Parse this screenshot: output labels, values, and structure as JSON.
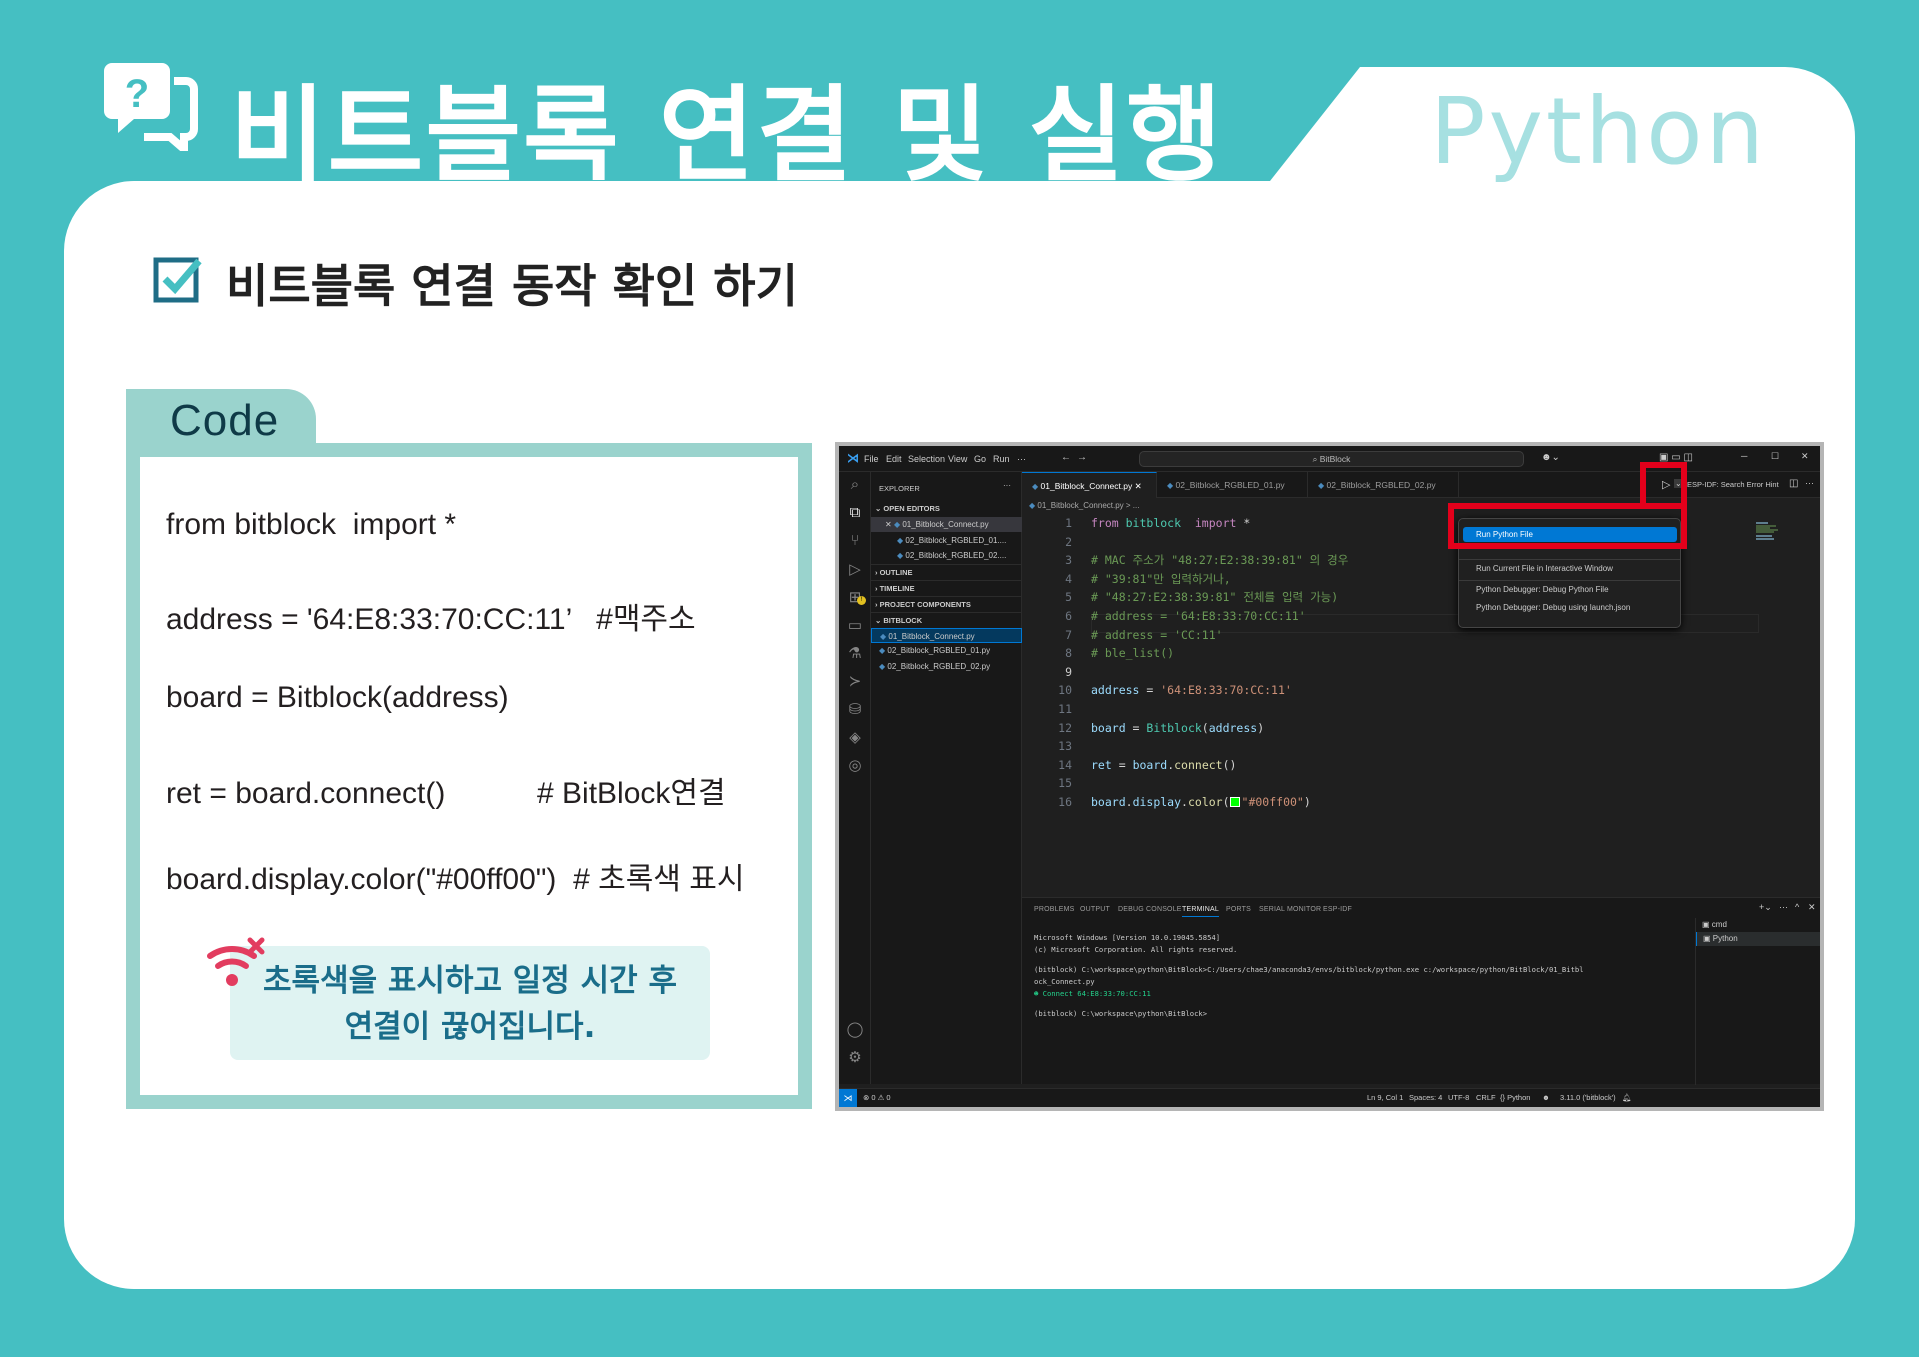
{
  "header": {
    "title": "비트블록 연결 및 실행",
    "language": "Python",
    "subtitle": "비트블록 연결 동작 확인 하기"
  },
  "code_panel": {
    "tab_label": "Code",
    "lines": [
      "from bitblock  import *",
      "address = '64:E8:33:70:CC:11’   #맥주소",
      "board = Bitblock(address)",
      "ret = board.connect()           # BitBlock연결",
      "board.display.color(\"#00ff00\")  # 초록색 표시"
    ],
    "note": [
      "초록색을 표시하고 일정 시간 후",
      "연결이 끊어집니다."
    ]
  },
  "vscode": {
    "menu": [
      "File",
      "Edit",
      "Selection",
      "View",
      "Go",
      "Run",
      "···"
    ],
    "search": "BitBlock",
    "sidebar": {
      "title": "EXPLORER",
      "more": "···",
      "open_editors": "OPEN EDITORS",
      "open_files": [
        "01_Bitblock_Connect.py",
        "02_Bitblock_RGBLED_01....",
        "02_Bitblock_RGBLED_02...."
      ],
      "outline": "OUTLINE",
      "timeline": "TIMELINE",
      "project_components": "PROJECT COMPONENTS",
      "folder": "BITBLOCK",
      "files": [
        "01_Bitblock_Connect.py",
        "02_Bitblock_RGBLED_01.py",
        "02_Bitblock_RGBLED_02.py"
      ]
    },
    "tabs": [
      "01_Bitblock_Connect.py",
      "02_Bitblock_RGBLED_01.py",
      "02_Bitblock_RGBLED_02.py"
    ],
    "breadcrumb": "01_Bitblock_Connect.py > ...",
    "esp_hint": "ESP-IDF: Search Error Hint",
    "editor": {
      "line_numbers": [
        "1",
        "2",
        "3",
        "4",
        "5",
        "6",
        "7",
        "8",
        "9",
        "10",
        "11",
        "12",
        "13",
        "14",
        "15",
        "16"
      ],
      "l1": [
        "from",
        " bitblock  ",
        "import",
        " *"
      ],
      "l3": "# MAC 주소가 \"48:27:E2:38:39:81\" 의 경우",
      "l4": "# \"39:81\"만 입력하거나,",
      "l5": "# \"48:27:E2:38:39:81\" 전체를 입력 가능)",
      "l6": "# address = '64:E8:33:70:CC:11'",
      "l7": "# address = 'CC:11'",
      "l8": "# ble_list()",
      "l10": [
        "address",
        " = ",
        "'64:E8:33:70:CC:11'"
      ],
      "l12": [
        "board",
        " = ",
        "Bitblock",
        "(",
        "address",
        ")"
      ],
      "l14": [
        "ret",
        " = ",
        "board",
        ".",
        "connect",
        "()"
      ],
      "l16": [
        "board",
        ".",
        "display",
        ".",
        "color",
        "(",
        "\"#00ff00\"",
        ")"
      ]
    },
    "run_menu": {
      "selected": "Run Python File",
      "items": [
        "Run Current File in Interactive Window",
        "Python Debugger: Debug Python File",
        "Python Debugger: Debug using launch.json"
      ]
    },
    "panel": {
      "tabs": [
        "PROBLEMS",
        "OUTPUT",
        "DEBUG CONSOLE",
        "TERMINAL",
        "PORTS",
        "SERIAL MONITOR",
        "ESP-IDF"
      ],
      "terminal": [
        "Microsoft Windows [Version 10.0.19045.5854]",
        "(c) Microsoft Corporation. All rights reserved.",
        "(bitblock) C:\\workspace\\python\\BitBlock>C:/Users/chae3/anaconda3/envs/bitblock/python.exe c:/workspace/python/BitBlock/01_Bitbl",
        "ock_Connect.py",
        "Connect 64:E8:33:70:CC:11",
        "(bitblock) C:\\workspace\\python\\BitBlock>"
      ],
      "terminals": [
        "cmd",
        "Python"
      ]
    },
    "statusbar": {
      "problems": "⊗ 0 ⚠ 0",
      "position": "Ln 9, Col 1",
      "spaces": "Spaces: 4",
      "encoding": "UTF-8",
      "eol": "CRLF",
      "language": "{} Python",
      "interpreter": "3.11.0 ('bitblock')"
    }
  },
  "colors": {
    "background": "#45bfc2",
    "accent": "#9ad3cd",
    "highlight_red": "#e3001b",
    "vscode_blue": "#0078d4"
  }
}
